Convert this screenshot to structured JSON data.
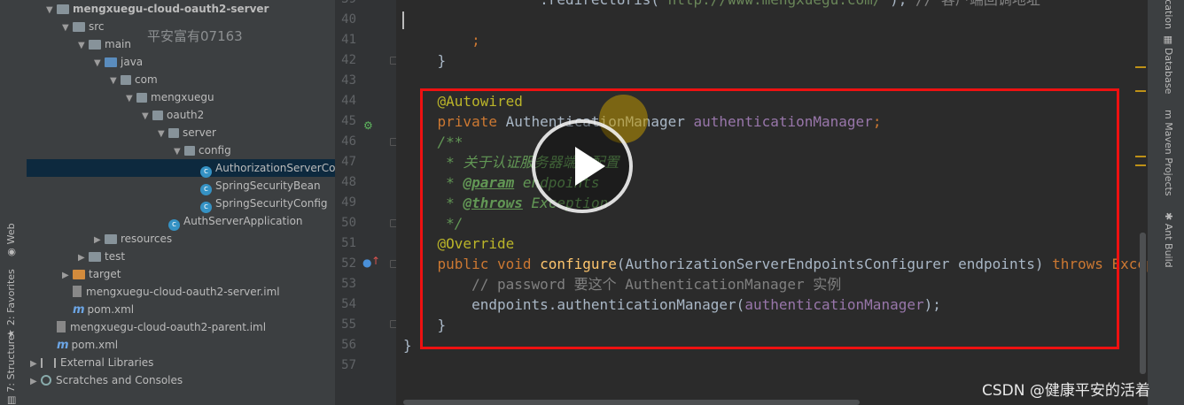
{
  "left_strip": {
    "tabs": [
      {
        "label": "Web",
        "icon": "web-icon"
      },
      {
        "label": "2: Favorites",
        "icon": "star-icon"
      },
      {
        "label": "7: Structure",
        "icon": "structure-icon"
      }
    ]
  },
  "watermark_top": "平安富有07163",
  "project_tree": [
    {
      "label": "mengxuegu-cloud-oauth2-server",
      "depth": 1,
      "expanded": true,
      "icon": "folder-icon",
      "bold": true
    },
    {
      "label": "src",
      "depth": 2,
      "expanded": true,
      "icon": "folder-icon"
    },
    {
      "label": "main",
      "depth": 3,
      "expanded": true,
      "icon": "folder-icon"
    },
    {
      "label": "java",
      "depth": 4,
      "expanded": true,
      "icon": "source-folder-icon"
    },
    {
      "label": "com",
      "depth": 5,
      "expanded": true,
      "icon": "package-icon"
    },
    {
      "label": "mengxuegu",
      "depth": 6,
      "expanded": true,
      "icon": "package-icon"
    },
    {
      "label": "oauth2",
      "depth": 7,
      "expanded": true,
      "icon": "package-icon"
    },
    {
      "label": "server",
      "depth": 8,
      "expanded": true,
      "icon": "package-icon"
    },
    {
      "label": "config",
      "depth": 9,
      "expanded": true,
      "icon": "package-icon"
    },
    {
      "label": "AuthorizationServerConfi",
      "depth": 10,
      "icon": "class-icon",
      "selected": true
    },
    {
      "label": "SpringSecurityBean",
      "depth": 10,
      "icon": "class-icon"
    },
    {
      "label": "SpringSecurityConfig",
      "depth": 10,
      "icon": "class-icon"
    },
    {
      "label": "AuthServerApplication",
      "depth": 8,
      "icon": "spring-class-icon"
    },
    {
      "label": "resources",
      "depth": 4,
      "expanded": false,
      "icon": "resources-folder-icon"
    },
    {
      "label": "test",
      "depth": 3,
      "expanded": false,
      "icon": "folder-icon"
    },
    {
      "label": "target",
      "depth": 2,
      "expanded": false,
      "icon": "excluded-folder-icon"
    },
    {
      "label": "mengxuegu-cloud-oauth2-server.iml",
      "depth": 2,
      "icon": "iml-file-icon"
    },
    {
      "label": "pom.xml",
      "depth": 2,
      "icon": "maven-file-icon"
    },
    {
      "label": "mengxuegu-cloud-oauth2-parent.iml",
      "depth": 1,
      "icon": "iml-file-icon"
    },
    {
      "label": "pom.xml",
      "depth": 1,
      "icon": "maven-file-icon"
    },
    {
      "label": "External Libraries",
      "depth": 0,
      "expanded": false,
      "icon": "libraries-icon"
    },
    {
      "label": "Scratches and Consoles",
      "depth": 0,
      "expanded": false,
      "icon": "scratches-icon"
    }
  ],
  "line_numbers": [
    "39",
    "40",
    "41",
    "42",
    "43",
    "44",
    "45",
    "46",
    "47",
    "48",
    "49",
    "50",
    "51",
    "52",
    "53",
    "54",
    "55",
    "56",
    "57"
  ],
  "code_lines": [
    [
      [
        "p",
        "                .redirectUris("
      ],
      [
        "str",
        "\"http://www.mengxuegu.com/\""
      ],
      [
        "p",
        ");"
      ],
      [
        "cmt",
        " // 客户端回调地址"
      ]
    ],
    [],
    [
      [
        "kw",
        "        ;"
      ]
    ],
    [
      [
        "p",
        "    }"
      ]
    ],
    [],
    [
      [
        "ann",
        "    @Autowired"
      ]
    ],
    [
      [
        "kw",
        "    private "
      ],
      [
        "p",
        "AuthenticationManager "
      ],
      [
        "fld",
        "authenticationManager"
      ],
      [
        "kw",
        ";"
      ]
    ],
    [
      [
        "doc",
        "    /**"
      ]
    ],
    [
      [
        "doc",
        "     * 关于认证服务器端点配置"
      ]
    ],
    [
      [
        "doc",
        "     * "
      ],
      [
        "tag",
        "@param"
      ],
      [
        "doc",
        " endpoints"
      ]
    ],
    [
      [
        "doc",
        "     * "
      ],
      [
        "tag",
        "@throws"
      ],
      [
        "doc",
        " Exception"
      ]
    ],
    [
      [
        "doc",
        "     */"
      ]
    ],
    [
      [
        "ann",
        "    @Override"
      ]
    ],
    [
      [
        "kw",
        "    public void "
      ],
      [
        "fn",
        "configure"
      ],
      [
        "p",
        "(AuthorizationServerEndpointsConfigurer endpoints) "
      ],
      [
        "kw",
        "throws Exception {"
      ]
    ],
    [
      [
        "cmt",
        "        // password 要这个 AuthenticationManager 实例"
      ]
    ],
    [
      [
        "p",
        "        endpoints.authenticationManager("
      ],
      [
        "fld",
        "authenticationManager"
      ],
      [
        "p",
        ");"
      ]
    ],
    [
      [
        "p",
        "    }"
      ]
    ],
    [
      [
        "p",
        "}"
      ]
    ],
    []
  ],
  "right_strip": {
    "tabs": [
      {
        "label": "Notification",
        "icon": "notification-icon"
      },
      {
        "label": "Database",
        "icon": "database-icon"
      },
      {
        "label": "Maven Projects",
        "icon": "maven-icon"
      },
      {
        "label": "Ant Build",
        "icon": "ant-icon"
      }
    ]
  },
  "video_overlay": {
    "icon": "play-icon"
  },
  "csdn_watermark": "CSDN @健康平安的活着",
  "colors": {
    "highlight_box": "#ee1111",
    "selection": "#0d293e",
    "background": "#2b2b2b"
  }
}
